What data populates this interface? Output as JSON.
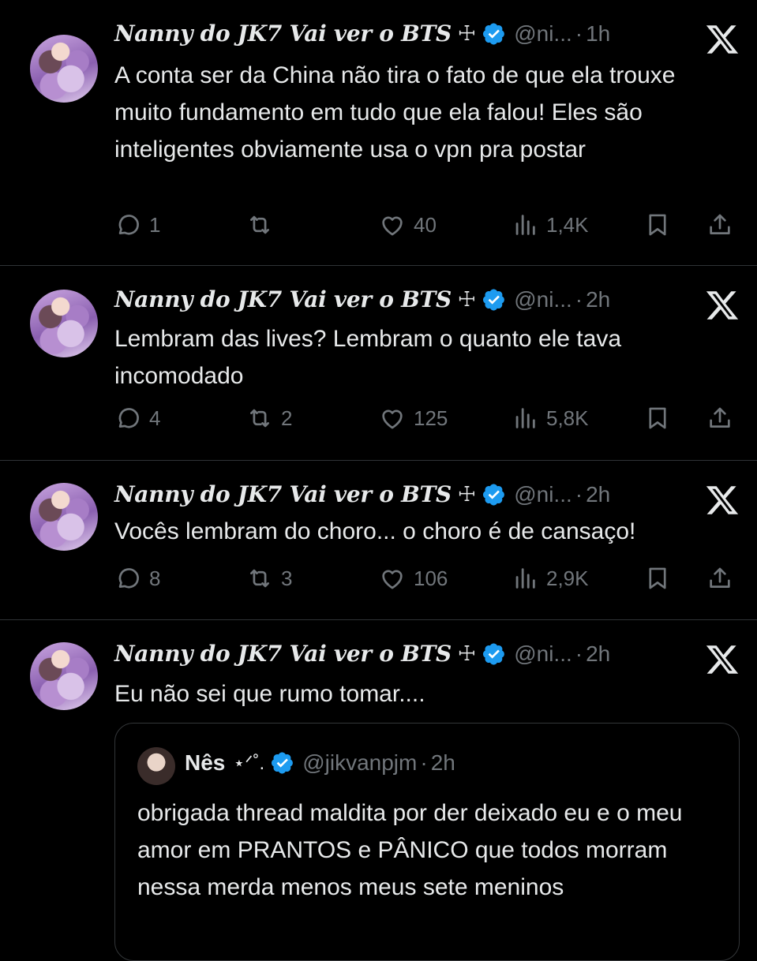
{
  "colors": {
    "background": "#000000",
    "text": "#e7e9ea",
    "muted": "#71767b",
    "verified": "#1d9bf0",
    "divider": "#2f3336"
  },
  "tweets": [
    {
      "name": "Nanny do JK7 Vai ver o BTS",
      "cross": "☩",
      "handle": "@ni...",
      "dot": "·",
      "time": "1h",
      "text": "A conta ser da China não tira o fato de que ela trouxe muito fundamento em tudo que ela falou! Eles são inteligentes obviamente usa o vpn pra postar",
      "replies": "1",
      "reposts": "",
      "likes": "40",
      "views": "1,4K"
    },
    {
      "name": "Nanny do JK7 Vai ver o BTS",
      "cross": "☩",
      "handle": "@ni...",
      "dot": "·",
      "time": "2h",
      "text": "Lembram das lives? Lembram o quanto ele tava incomodado",
      "replies": "4",
      "reposts": "2",
      "likes": "125",
      "views": "5,8K"
    },
    {
      "name": "Nanny do JK7 Vai ver o BTS",
      "cross": "☩",
      "handle": "@ni...",
      "dot": "·",
      "time": "2h",
      "text": "Vocês lembram do choro... o choro é de cansaço!",
      "replies": "8",
      "reposts": "3",
      "likes": "106",
      "views": "2,9K"
    },
    {
      "name": "Nanny do JK7 Vai ver o BTS",
      "cross": "☩",
      "handle": "@ni...",
      "dot": "·",
      "time": "2h",
      "text": "Eu não sei que rumo tomar....",
      "quote": {
        "name": "Nês",
        "deco": "⋆ᐟ˚.",
        "handle": "@jikvanpjm",
        "dot": "·",
        "time": "2h",
        "text": "obrigada thread maldita por der deixado eu e o meu amor em PRANTOS e PÂNICO que todos morram nessa merda menos meus sete meninos"
      }
    }
  ]
}
